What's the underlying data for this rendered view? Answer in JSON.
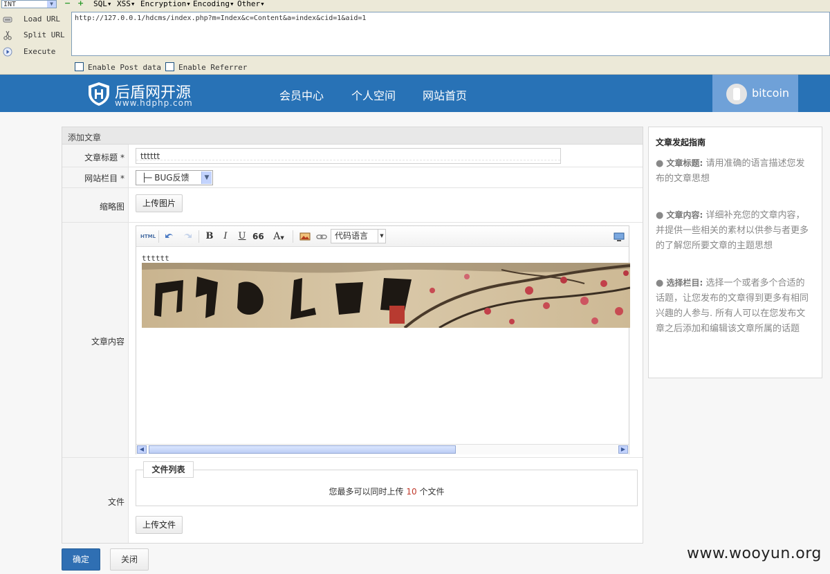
{
  "hackbar": {
    "select_value": "INT",
    "menus": [
      "SQL",
      "XSS",
      "Encryption",
      "Encoding",
      "Other"
    ],
    "actions": [
      "Load URL",
      "Split URL",
      "Execute"
    ],
    "url": "http://127.0.0.1/hdcms/index.php?m=Index&c=Content&a=index&cid=1&aid=1",
    "checkboxes": [
      "Enable Post data",
      "Enable Referrer"
    ]
  },
  "header": {
    "logo_name": "后盾网开源",
    "logo_url": "www.hdphp.com",
    "nav": [
      "会员中心",
      "个人空间",
      "网站首页"
    ],
    "username": "bitcoin"
  },
  "form": {
    "heading": "添加文章",
    "title_label": "文章标题",
    "title_value": "tttttt",
    "category_label": "网站栏目",
    "category_value": "├─ BUG反馈",
    "required_mark": "*",
    "thumb_label": "缩略图",
    "upload_image": "上传图片",
    "content_label": "文章内容",
    "editor": {
      "html_btn": "HTML",
      "bold": "B",
      "italic": "I",
      "underline": "U",
      "quote": "66",
      "font": "A",
      "code_lang": "代码语言",
      "text": "tttttt"
    },
    "files_label": "文件",
    "file_list_legend": "文件列表",
    "file_note_prefix": "您最多可以同时上传",
    "file_note_num": "10",
    "file_note_suffix": "个文件",
    "upload_file": "上传文件"
  },
  "buttons": {
    "ok": "确定",
    "close": "关闭"
  },
  "guide": {
    "title": "文章发起指南",
    "items": [
      {
        "term": "文章标题:",
        "text": "请用准确的语言描述您发布的文章思想"
      },
      {
        "term": "文章内容:",
        "text": "详细补充您的文章内容，并提供一些相关的素材以供参与者更多的了解您所要文章的主题思想"
      },
      {
        "term": "选择栏目:",
        "text": "选择一个或者多个合适的话题，让您发布的文章得到更多有相同兴趣的人参与. 所有人可以在您发布文章之后添加和编辑该文章所属的话题"
      }
    ]
  },
  "watermark": "www.wooyun.org"
}
